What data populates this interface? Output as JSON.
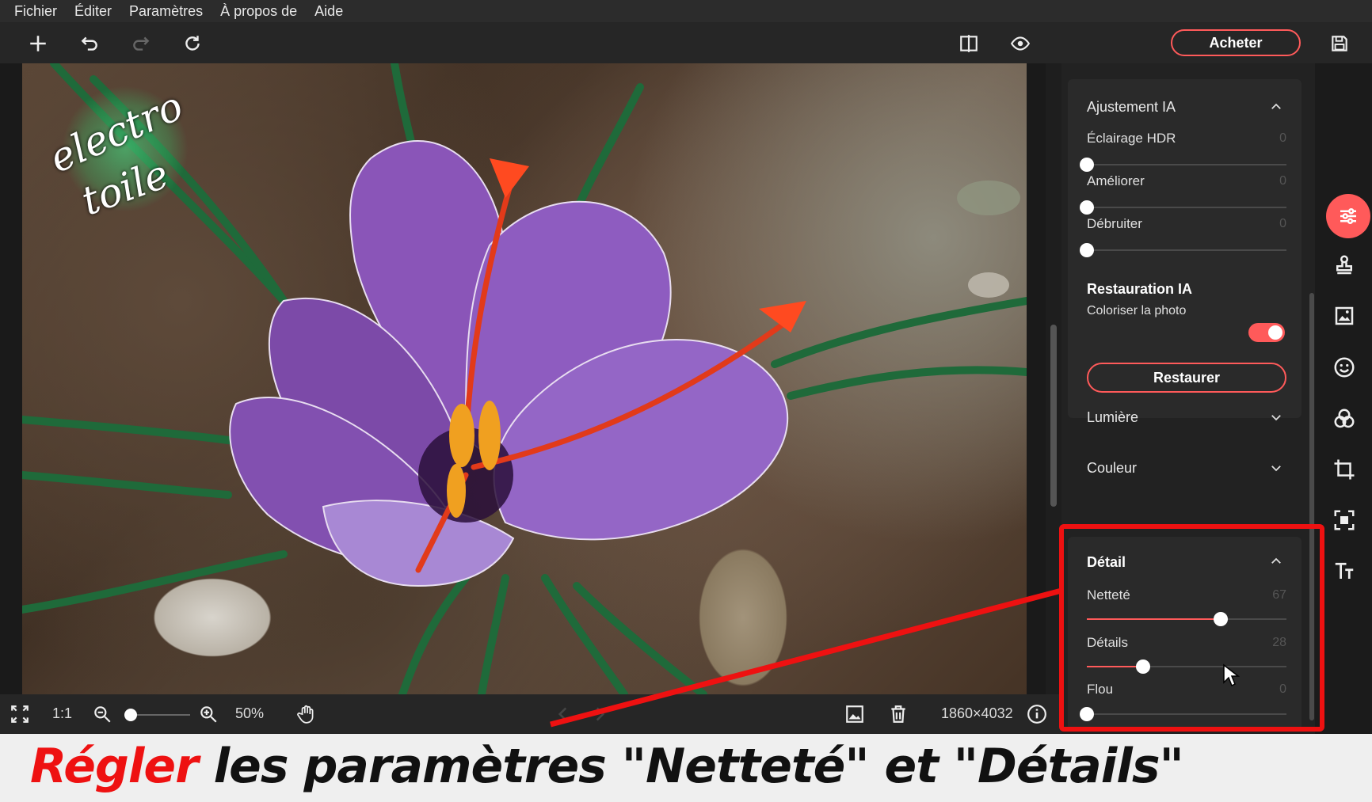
{
  "menu": {
    "items": [
      "Fichier",
      "Éditer",
      "Paramètres",
      "À propos de",
      "Aide"
    ]
  },
  "toolbar": {
    "buy_label": "Acheter"
  },
  "watermark": {
    "line1": "electro",
    "line2": "toile"
  },
  "bottom": {
    "ratio_label": "1:1",
    "zoom_value": "50%",
    "dimensions": "1860×4032"
  },
  "panel": {
    "ai_adjust": {
      "title": "Ajustement IA",
      "sliders": [
        {
          "label": "Éclairage HDR",
          "value": 0
        },
        {
          "label": "Améliorer",
          "value": 0
        },
        {
          "label": "Débruiter",
          "value": 0
        }
      ]
    },
    "ai_restore": {
      "title": "Restauration IA",
      "colorize_label": "Coloriser la photo",
      "colorize_on": true,
      "restore_button": "Restaurer"
    },
    "lumiere": {
      "title": "Lumière"
    },
    "couleur": {
      "title": "Couleur"
    },
    "detail": {
      "title": "Détail",
      "sliders": [
        {
          "label": "Netteté",
          "value": 67
        },
        {
          "label": "Détails",
          "value": 28
        },
        {
          "label": "Flou",
          "value": 0
        }
      ]
    }
  },
  "strip": {
    "icons": [
      "adjust-sliders-icon",
      "stamp-icon",
      "image-frame-icon",
      "face-icon",
      "color-circles-icon",
      "crop-icon",
      "select-area-icon",
      "text-icon"
    ]
  },
  "caption": {
    "highlight": "Régler",
    "rest": " les paramètres \"Netteté\" et \"Détails\""
  },
  "colors": {
    "accent": "#ff5a5a",
    "annotation_red": "#e11111"
  }
}
